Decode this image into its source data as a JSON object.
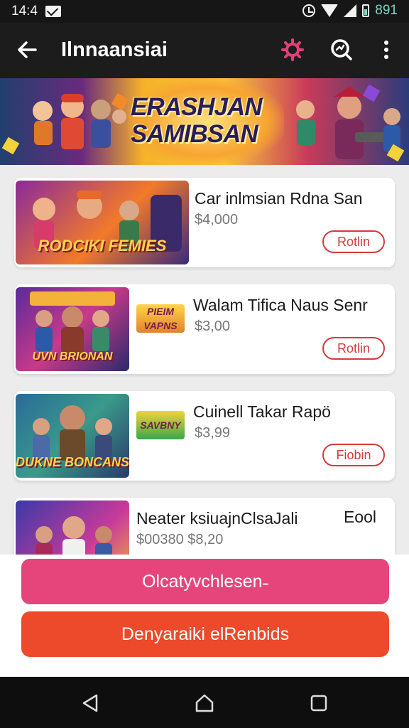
{
  "status_bar": {
    "time": "14:4",
    "battery_text": "891",
    "icons": [
      "mail-icon",
      "alarm-icon",
      "wifi-icon",
      "signal-icon",
      "battery-icon"
    ]
  },
  "app_bar": {
    "title": "Ilnnaansiai",
    "icons": [
      "back-arrow-icon",
      "settings-icon",
      "search-icon",
      "more-vert-icon"
    ],
    "accent": "#e0407a"
  },
  "banner": {
    "headline_line1": "ERASHJAN",
    "headline_line2": "SAMIBSAN"
  },
  "items": [
    {
      "thumb_label": "RODCIKI FEMIES",
      "name": "Car inlmsian Rdna San",
      "price": "$4,000",
      "button": "Rotlin"
    },
    {
      "thumb_label": "UVN BRIONAN",
      "mini_logo": "PIEIM VAPNS",
      "name": "Walam Tifica Naus Senr",
      "price": "$3,00",
      "button": "Rotlin"
    },
    {
      "thumb_label": "DUKNE BONCANS",
      "mini_logo": "SAVBNY",
      "name": "Cuinell Takar Rapö",
      "price": "$3,99",
      "button": "Fiobin"
    },
    {
      "name": "Neater ksiuajnClsaJali",
      "extra": "Eool",
      "price": "$00380  $8,20"
    }
  ],
  "buttons": {
    "primary": "Olcatyvchlesen˗",
    "secondary": "Denyaraiki elRenbids"
  },
  "colors": {
    "primary_button": "#e5457a",
    "secondary_button": "#ec4a2b",
    "action_outline": "#d63a3a"
  },
  "nav_bar": {
    "icons": [
      "back-triangle-icon",
      "home-icon",
      "recents-icon"
    ]
  }
}
